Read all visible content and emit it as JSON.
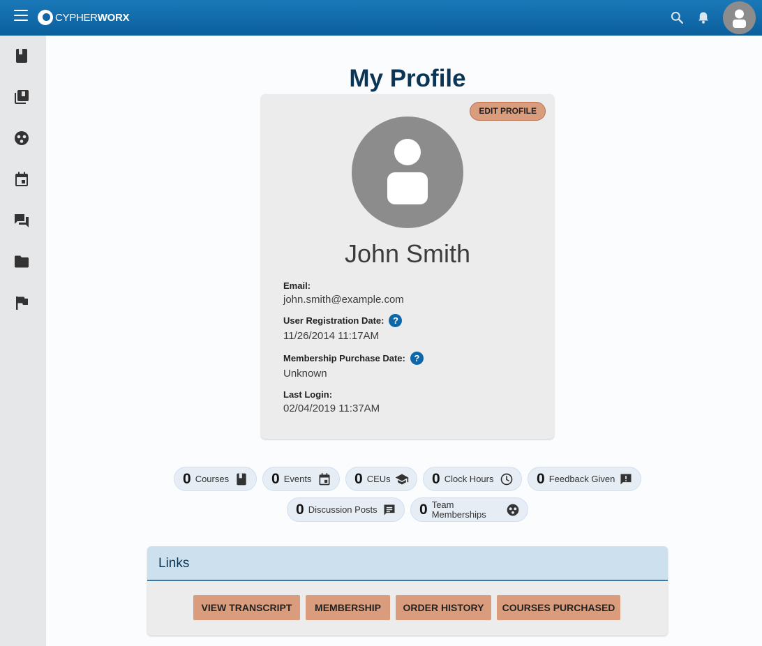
{
  "header": {
    "logo_text_light": "CYPHER",
    "logo_text_bold": "WORX"
  },
  "page": {
    "title": "My Profile"
  },
  "profile": {
    "edit_label": "EDIT PROFILE",
    "name": "John Smith",
    "email_label": "Email:",
    "email": "john.smith@example.com",
    "registration_label": "User Registration Date:",
    "registration_date": "11/26/2014 11:17AM",
    "membership_label": "Membership Purchase Date:",
    "membership_date": "Unknown",
    "last_login_label": "Last Login:",
    "last_login": "02/04/2019 11:37AM",
    "help_glyph": "?"
  },
  "stats": [
    {
      "count": "0",
      "label": "Courses",
      "icon": "book-icon"
    },
    {
      "count": "0",
      "label": "Events",
      "icon": "calendar-icon"
    },
    {
      "count": "0",
      "label": "CEUs",
      "icon": "graduation-cap-icon"
    },
    {
      "count": "0",
      "label": "Clock Hours",
      "icon": "clock-icon"
    },
    {
      "count": "0",
      "label": "Feedback Given",
      "icon": "feedback-icon"
    },
    {
      "count": "0",
      "label": "Discussion Posts",
      "icon": "chat-icon"
    },
    {
      "count": "0",
      "label_line1": "Team",
      "label_line2": "Memberships",
      "icon": "team-icon"
    }
  ],
  "links": {
    "title": "Links",
    "buttons": [
      "VIEW TRANSCRIPT",
      "MEMBERSHIP",
      "ORDER HISTORY",
      "COURSES PURCHASED"
    ]
  },
  "sidebar": {
    "items": [
      "book-icon",
      "library-icon",
      "team-icon",
      "calendar-icon",
      "forum-icon",
      "folder-icon",
      "flag-icon"
    ]
  },
  "colors": {
    "header": "#0f67a8",
    "accent_button": "#d99d7e",
    "title": "#0b3554",
    "sidebar": "#e6e7e9"
  }
}
